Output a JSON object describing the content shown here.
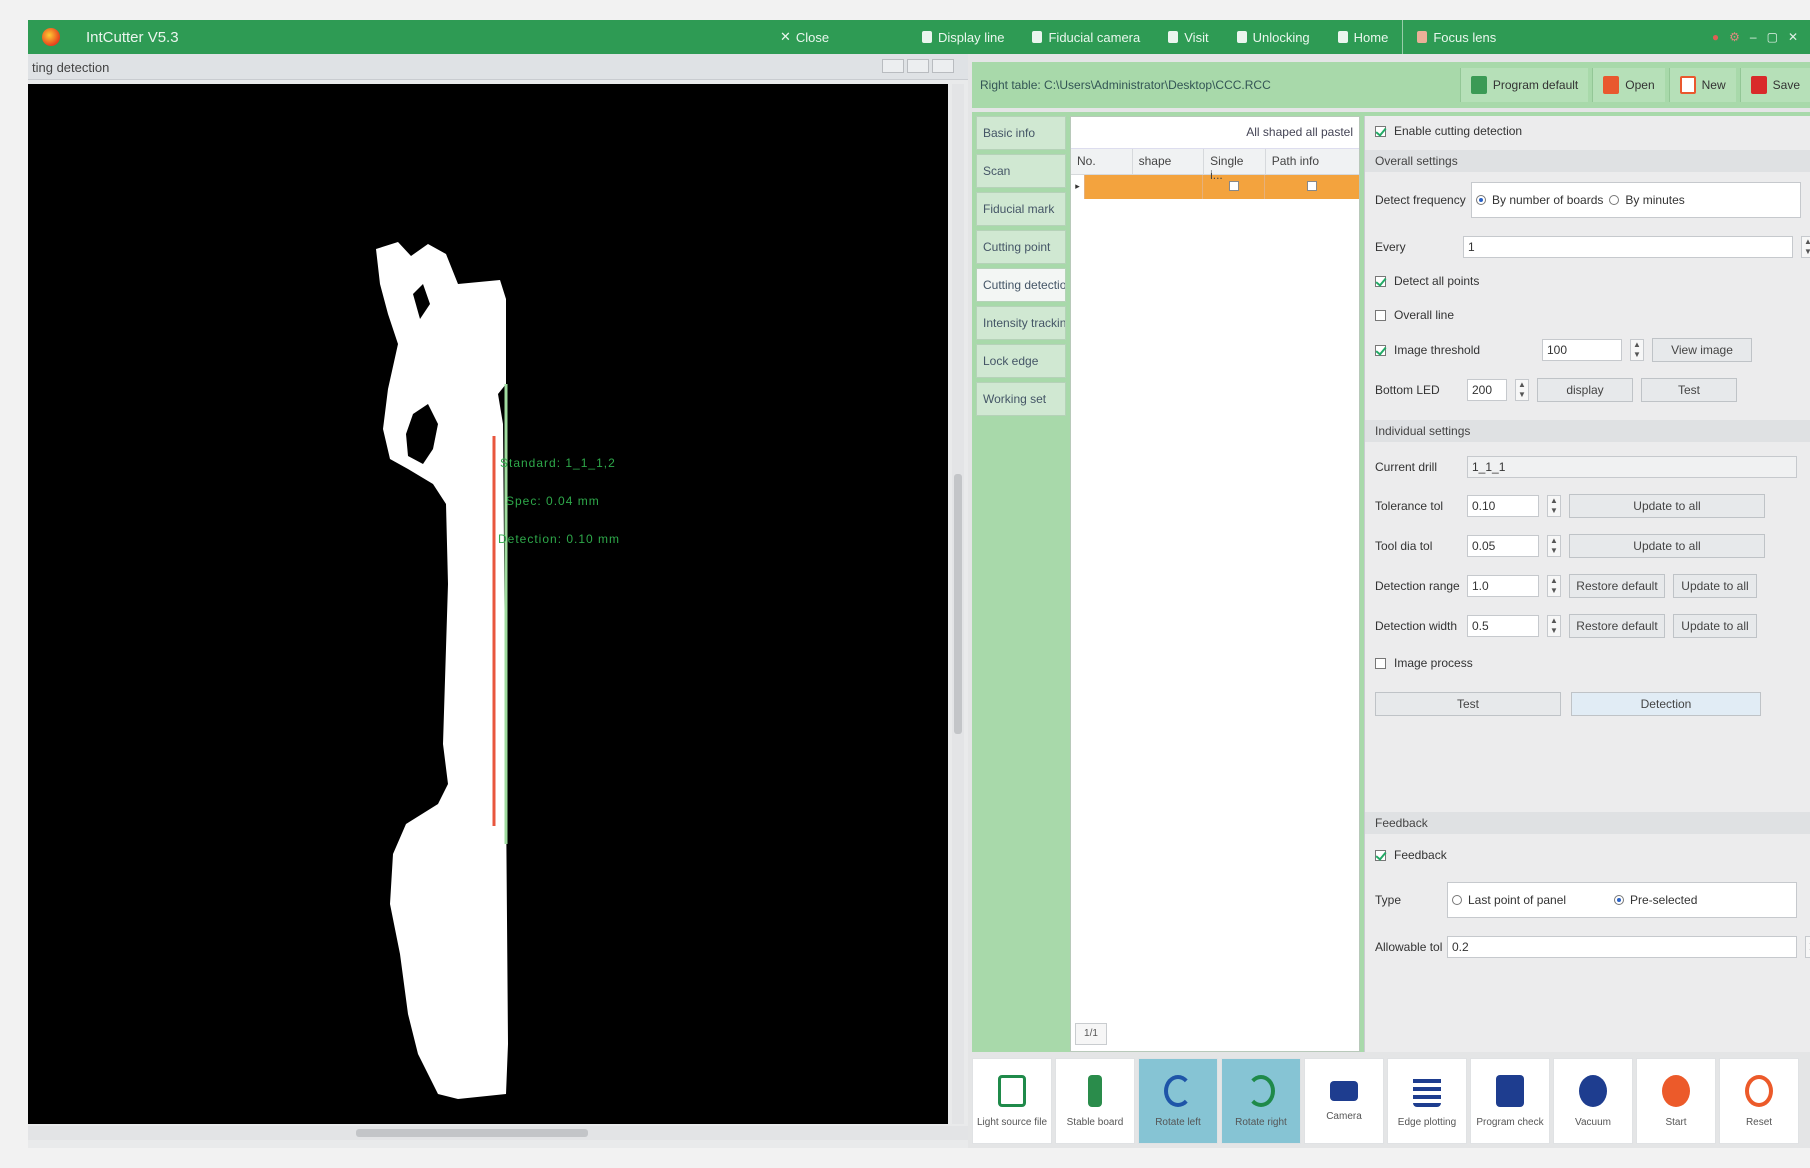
{
  "app": {
    "title": "IntCutter V5.3",
    "top_menu": [
      "Close",
      "Display line",
      "Fiducial camera",
      "Visit",
      "Unlocking",
      "Home",
      "Focus lens"
    ],
    "left_panel_title": "ting detection"
  },
  "canvas": {
    "measure_lines": [
      "Standard: 1_1_1,2",
      "Spec: 0.04 mm",
      "Detection: 0.10 mm"
    ]
  },
  "right": {
    "file_label": "Right table: C:\\Users\\Administrator\\Desktop\\CCC.RCC",
    "actions": [
      "Program default",
      "Open",
      "New",
      "Save"
    ],
    "tabs": [
      "Basic info",
      "Scan",
      "Fiducial mark",
      "Cutting point",
      "Cutting detection",
      "Intensity tracking",
      "Lock edge",
      "Working set"
    ],
    "active_tab_index": 4,
    "list": {
      "header": "All shaped  all pastel",
      "columns": [
        "No.",
        "shape",
        "Single i...",
        "Path info"
      ]
    },
    "settings": {
      "enable_label": "Enable cutting detection",
      "overall_title": "Overall settings",
      "detect_frequency_label": "Detect frequency",
      "freq_opt1": "By number of boards",
      "freq_opt2": "By minutes",
      "every_label": "Every",
      "every_value": "1",
      "detect_all_points": "Detect all points",
      "overall_line": "Overall line",
      "image_threshold": "Image threshold",
      "threshold_value": "100",
      "view_image": "View image",
      "bottom_led": "Bottom LED",
      "led_value": "200",
      "display_btn": "display",
      "test_btn": "Test",
      "individual_title": "Individual settings",
      "current_drill": "Current drill",
      "current_drill_value": "1_1_1",
      "tolerance_label": "Tolerance tol",
      "tolerance_value": "0.10",
      "tool_label": "Tool dia tol",
      "tool_value": "0.05",
      "det_range_label": "Detection range",
      "det_range_value": "1.0",
      "det_width_label": "Detection width",
      "det_width_value": "0.5",
      "update_all": "Update to all",
      "restore_default": "Restore default",
      "image_process": "Image process",
      "test_button": "Test",
      "detection_button": "Detection",
      "feedback_title": "Feedback",
      "feedback_check": "Feedback",
      "type_label": "Type",
      "type_opt1": "Last point of panel",
      "type_opt2": "Pre-selected",
      "allowable_label": "Allowable tol",
      "allowable_value": "0.2"
    },
    "list_footer": "1/1",
    "bottom_tools": [
      "Light source file",
      "Stable board",
      "Rotate left",
      "Rotate right",
      "Camera",
      "Edge plotting",
      "Program check",
      "Vacuum",
      "Start",
      "Reset"
    ],
    "highlighted_tools": [
      2,
      3
    ]
  },
  "colors": {
    "brand_green": "#2e9b54",
    "panel_green": "#a8d9aa",
    "row_orange": "#f3a33e",
    "highlight_blue": "#86c4d4"
  }
}
